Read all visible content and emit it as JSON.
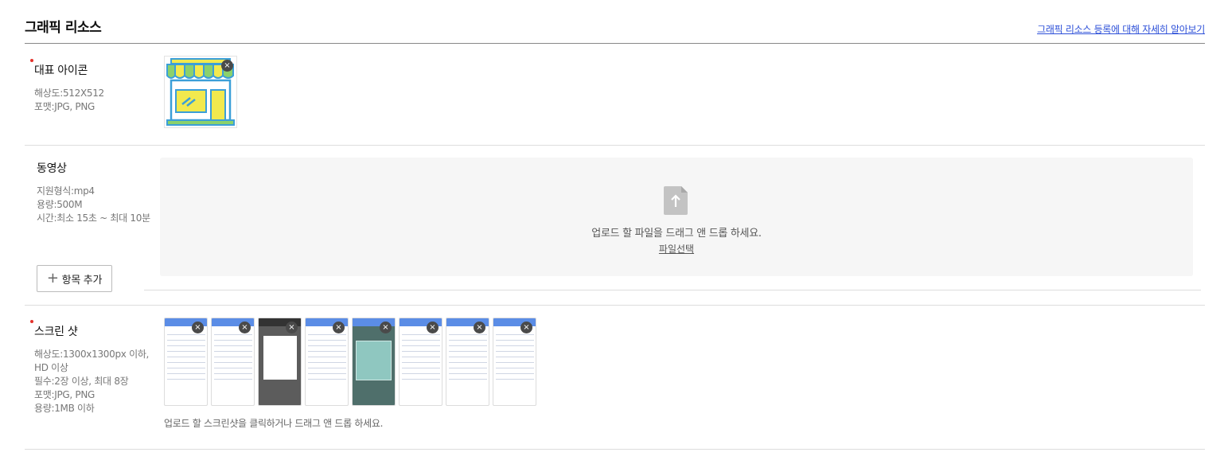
{
  "header": {
    "title": "그래픽 리소스",
    "help_link": "그래픽 리소스 등록에 대해 자세히 알아보기"
  },
  "icon_section": {
    "label": "대표 아이콘",
    "specs": [
      "해상도:512X512",
      "포맷:JPG, PNG"
    ],
    "remove": "×"
  },
  "video_section": {
    "label": "동영상",
    "specs": [
      "지원형식:mp4",
      "용량:500M",
      "시간:최소 15초 ~ 최대 10분"
    ],
    "drop_text": "업로드 할 파일을 드래그 앤 드롭 하세요.",
    "file_select": "파일선택",
    "add_button": "항목 추가",
    "add_icon": "+"
  },
  "shots_section": {
    "label": "스크린 샷",
    "specs": [
      "해상도:1300x1300px 이하,",
      "HD 이상",
      "필수:2장 이상, 최대 8장",
      "포맷:JPG, PNG",
      "용량:1MB 이하"
    ],
    "hint": "업로드 할 스크린샷을 클릭하거나 드래그 앤 드롭 하세요.",
    "remove": "×",
    "thumbnails": [
      {
        "kind": "list"
      },
      {
        "kind": "list"
      },
      {
        "kind": "dark"
      },
      {
        "kind": "list"
      },
      {
        "kind": "photo"
      },
      {
        "kind": "list"
      },
      {
        "kind": "list"
      },
      {
        "kind": "list"
      }
    ]
  },
  "colors": {
    "required": "#e4322b",
    "link": "#2c4fd8",
    "awning_yellow": "#f2e94e",
    "awning_green": "#8bd16b",
    "store_blue": "#3b9fd8"
  }
}
